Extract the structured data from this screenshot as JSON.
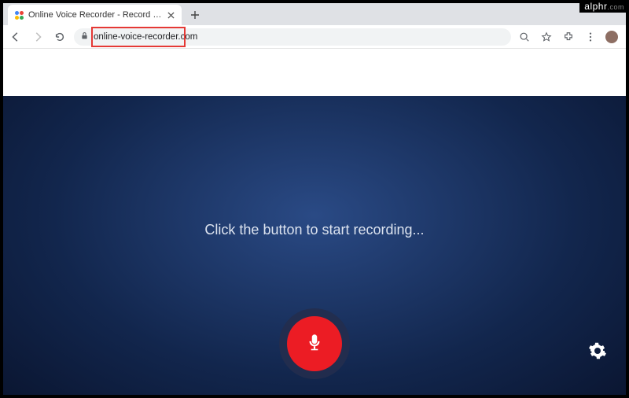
{
  "tab": {
    "title": "Online Voice Recorder - Record …",
    "favicon_colors": [
      "#4285F4",
      "#EA4335",
      "#FBBC05",
      "#34A853"
    ]
  },
  "toolbar": {
    "url": "online-voice-recorder.com"
  },
  "page": {
    "instruction": "Click the button to start recording..."
  },
  "watermark": {
    "brand": "alphr",
    "suffix": ".com"
  }
}
